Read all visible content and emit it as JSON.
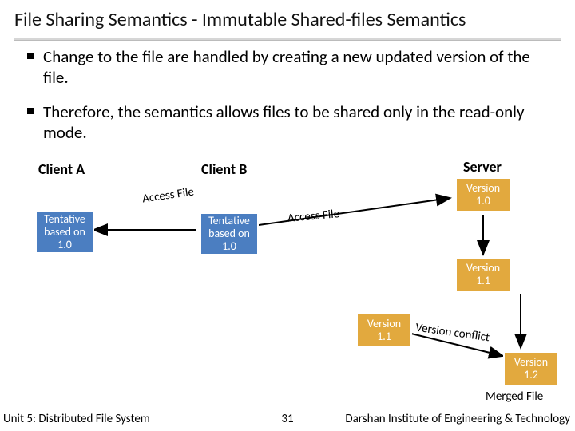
{
  "title": "File Sharing Semantics - Immutable Shared-files Semantics",
  "bullets": [
    "Change to the file are handled by creating a new updated version of the file.",
    "Therefore, the semantics allows files to be shared only in the read-only mode."
  ],
  "labels": {
    "clientA": "Client A",
    "clientB": "Client B",
    "server": "Server",
    "accessFile": "Access File",
    "versionConflict": "Version conflict",
    "mergedFile": "Merged File"
  },
  "boxes": {
    "tentativeA": "Tentative based on 1.0",
    "tentativeB": "Tentative based on 1.0",
    "v10": "Version 1.0",
    "v11s": "Version 1.1",
    "v11c": "Version 1.1",
    "v12": "Version 1.2"
  },
  "footer": {
    "left": "Unit 5: Distributed File System",
    "mid": "31",
    "right": "Darshan Institute of Engineering & Technology"
  }
}
